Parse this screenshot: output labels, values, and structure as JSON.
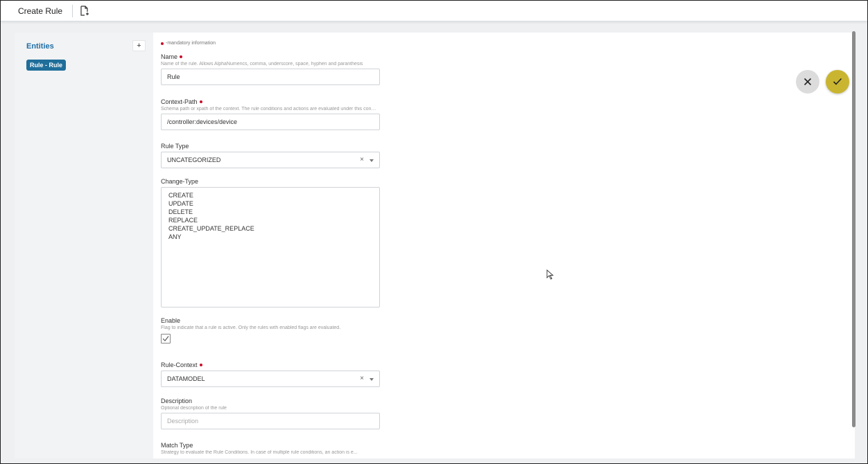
{
  "header": {
    "title": "Create Rule",
    "doc_icon": "document-add-icon"
  },
  "sidebar": {
    "title": "Entities",
    "add_label": "+",
    "chip": "Rule - Rule"
  },
  "form": {
    "mandatory_note": "-mandatory information",
    "name": {
      "label": "Name",
      "help": "Name of the rule. Allows AlphaNumerics, comma, underscore, space, hyphen and paranthesis",
      "value": "Rule"
    },
    "context_path": {
      "label": "Context-Path",
      "help": "Schema path or xpath of the context. The rule conditions and actions are evaluated under this context",
      "value": "/controller:devices/device"
    },
    "rule_type": {
      "label": "Rule Type",
      "value": "UNCATEGORIZED",
      "clear": "×"
    },
    "change_type": {
      "label": "Change-Type",
      "options": [
        "CREATE",
        "UPDATE",
        "DELETE",
        "REPLACE",
        "CREATE_UPDATE_REPLACE",
        "ANY"
      ]
    },
    "enable": {
      "label": "Enable",
      "help": "Flag to indicate that a rule is active. Only the rules with enabled flags are evaluated.",
      "checked": true
    },
    "rule_context": {
      "label": "Rule-Context",
      "value": "DATAMODEL",
      "clear": "×"
    },
    "description": {
      "label": "Description",
      "help": "Optional description of the rule",
      "placeholder": "Description"
    },
    "match_type": {
      "label": "Match Type",
      "help": "Strategy to evaluate the Rule Conditions. In case of multiple rule conditions, an action is e..."
    }
  },
  "actions": {
    "cancel_icon": "close-icon",
    "confirm_icon": "check-icon"
  },
  "colors": {
    "accent": "#1f6e9a",
    "confirm": "#c9b530",
    "required": "#c8102e"
  }
}
